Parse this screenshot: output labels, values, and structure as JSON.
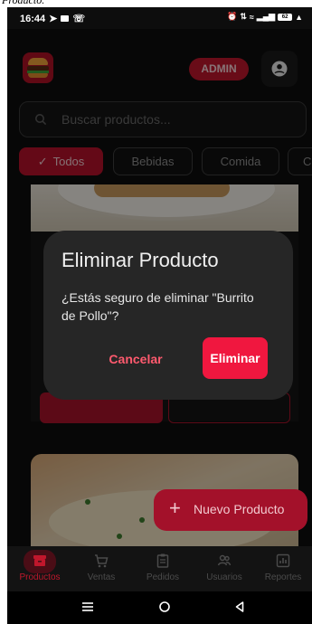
{
  "top_strip": {
    "text": "Producto."
  },
  "status_bar": {
    "time": "16:44",
    "right_icons": [
      "alarm-icon",
      "data-speed-icon",
      "wifi-icon",
      "signal-icon",
      "battery-icon",
      "alert-icon"
    ],
    "battery_level": "62"
  },
  "header": {
    "logo": "burger-logo",
    "role_badge": "ADMIN",
    "profile_icon": "account-circle-icon"
  },
  "search": {
    "placeholder": "Buscar productos..."
  },
  "filters": {
    "items": [
      {
        "label": "Todos",
        "active": true
      },
      {
        "label": "Bebidas",
        "active": false
      },
      {
        "label": "Comida",
        "active": false
      },
      {
        "label": "C",
        "active": false
      }
    ]
  },
  "dialog": {
    "title": "Eliminar Producto",
    "message": "¿Estás seguro de eliminar \"Burrito de Pollo\"?",
    "cancel_label": "Cancelar",
    "confirm_label": "Eliminar"
  },
  "fab": {
    "label": "Nuevo Producto"
  },
  "bottom_nav": {
    "items": [
      {
        "label": "Productos",
        "icon": "archive-box-icon",
        "active": true
      },
      {
        "label": "Ventas",
        "icon": "cart-icon",
        "active": false
      },
      {
        "label": "Pedidos",
        "icon": "clipboard-icon",
        "active": false
      },
      {
        "label": "Usuarios",
        "icon": "users-icon",
        "active": false
      },
      {
        "label": "Reportes",
        "icon": "bar-chart-icon",
        "active": false
      }
    ]
  },
  "colors": {
    "accent": "#c0172c",
    "confirm": "#f0173f",
    "background": "#0d0d0d",
    "dialog": "#262626"
  }
}
